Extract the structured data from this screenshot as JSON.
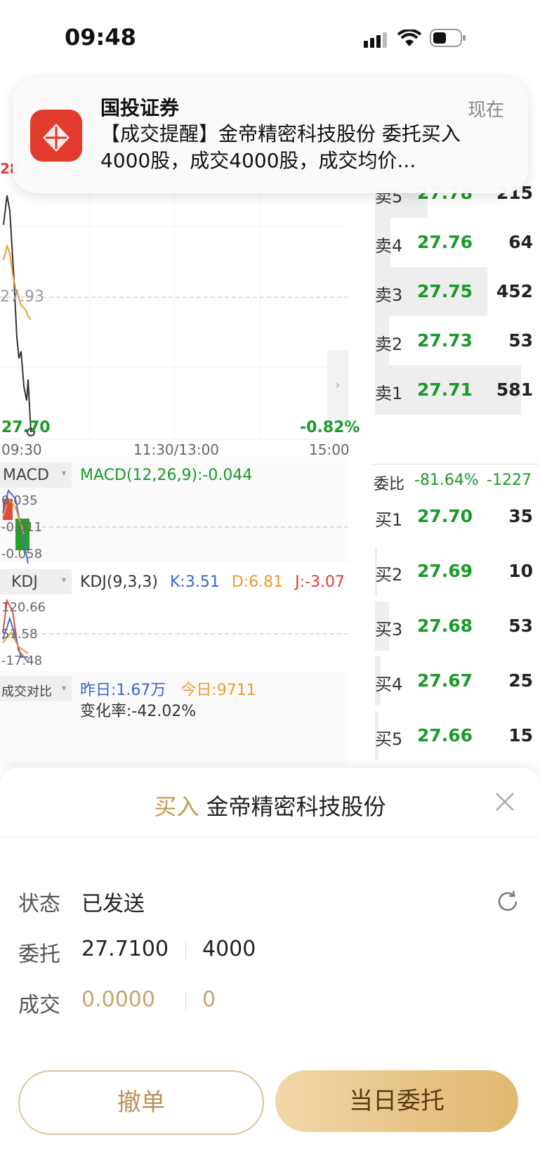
{
  "status_bar": {
    "time": "09:48"
  },
  "notification": {
    "app_name": "国投证券",
    "time": "现在",
    "body": "【成交提醒】金帝精密科技股份 委托买入4000股，成交4000股，成交均价..."
  },
  "chart": {
    "price_top": "28",
    "price_mid": "27.93",
    "price_low": "27.70",
    "change_pct": "-0.82%",
    "time_labels": [
      "09:30",
      "11:30/13:00",
      "15:00"
    ],
    "macd": {
      "name": "MACD",
      "params": "MACD(12,26,9):-0.044",
      "ticks": [
        "0.035",
        "-0.011",
        "-0.058"
      ]
    },
    "kdj": {
      "name": "KDJ",
      "params": "KDJ(9,3,3)",
      "k": "K:3.51",
      "d": "D:6.81",
      "j": "J:-3.07",
      "ticks": [
        "120.66",
        "51.58",
        "-17.48"
      ]
    },
    "volume_compare": {
      "name": "成交对比",
      "yesterday": "昨日:1.67万",
      "today": "今日:9711",
      "change_rate": "变化率:-42.02%"
    }
  },
  "orderbook": {
    "asks": [
      {
        "side": "卖5",
        "price": "27.78",
        "volume": "215"
      },
      {
        "side": "卖4",
        "price": "27.76",
        "volume": "64"
      },
      {
        "side": "卖3",
        "price": "27.75",
        "volume": "452"
      },
      {
        "side": "卖2",
        "price": "27.73",
        "volume": "53"
      },
      {
        "side": "卖1",
        "price": "27.71",
        "volume": "581"
      }
    ],
    "weibi": {
      "label": "委比",
      "pct": "-81.64%",
      "diff": "-1227"
    },
    "bids": [
      {
        "side": "买1",
        "price": "27.70",
        "volume": "35"
      },
      {
        "side": "买2",
        "price": "27.69",
        "volume": "10"
      },
      {
        "side": "买3",
        "price": "27.68",
        "volume": "53"
      },
      {
        "side": "买4",
        "price": "27.67",
        "volume": "25"
      },
      {
        "side": "买5",
        "price": "27.66",
        "volume": "15"
      }
    ]
  },
  "order_sheet": {
    "action": "买入",
    "stock": "金帝精密科技股份",
    "status_label": "状态",
    "status_value": "已发送",
    "order_label": "委托",
    "order_price": "27.7100",
    "order_qty": "4000",
    "fill_label": "成交",
    "fill_price": "0.0000",
    "fill_qty": "0",
    "cancel_button": "撤单",
    "today_orders_button": "当日委托"
  },
  "colors": {
    "up": "#e0403a",
    "down": "#1a9a28",
    "gold": "#c9a46a"
  }
}
